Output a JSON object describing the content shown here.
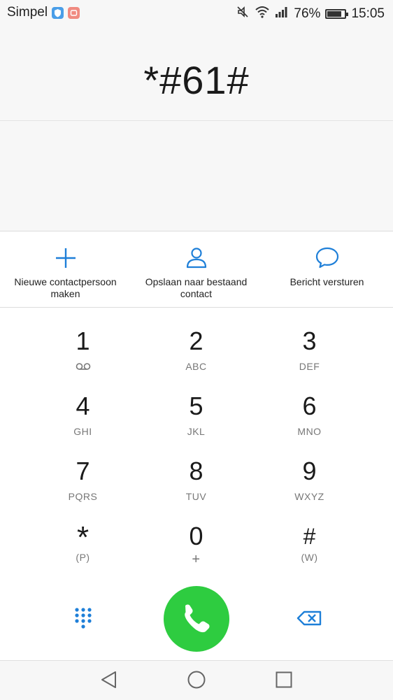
{
  "status": {
    "carrier": "Simpel",
    "battery_percent": "76%",
    "time": "15:05",
    "icons": [
      "shield-icon",
      "android-icon",
      "mute-icon",
      "wifi-icon",
      "signal-icon",
      "battery-icon"
    ]
  },
  "dialer": {
    "entered_number": "*#61#"
  },
  "actions": [
    {
      "label": "Nieuwe contactpersoon maken",
      "icon": "plus-icon"
    },
    {
      "label": "Opslaan naar bestaand contact",
      "icon": "person-icon"
    },
    {
      "label": "Bericht versturen",
      "icon": "message-icon"
    }
  ],
  "keys": [
    {
      "digit": "1",
      "letters": ""
    },
    {
      "digit": "2",
      "letters": "ABC"
    },
    {
      "digit": "3",
      "letters": "DEF"
    },
    {
      "digit": "4",
      "letters": "GHI"
    },
    {
      "digit": "5",
      "letters": "JKL"
    },
    {
      "digit": "6",
      "letters": "MNO"
    },
    {
      "digit": "7",
      "letters": "PQRS"
    },
    {
      "digit": "8",
      "letters": "TUV"
    },
    {
      "digit": "9",
      "letters": "WXYZ"
    },
    {
      "digit": "*",
      "letters": "(P)"
    },
    {
      "digit": "0",
      "letters": "+"
    },
    {
      "digit": "#",
      "letters": "(W)"
    }
  ],
  "colors": {
    "accent": "#1e7fd8",
    "call_green": "#2ecc40",
    "background": "#f7f7f7"
  }
}
